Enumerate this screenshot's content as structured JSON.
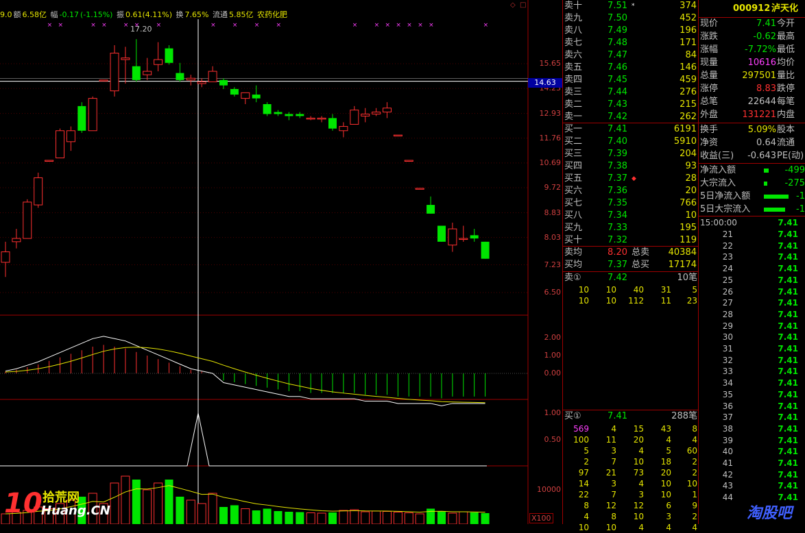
{
  "info_bar": {
    "prefix": "9.0",
    "amount_label": "额",
    "amount_value": "6.58亿",
    "change_label": "幅",
    "change_value": "-0.17",
    "change_pct": "(-1.15%)",
    "amp_label": "振",
    "amp_value": "0.61(4.11%)",
    "turnover_label": "换",
    "turnover_value": "7.65%",
    "float_label": "流通",
    "float_value": "5.85亿",
    "sector": "农药化肥"
  },
  "price_axis": [
    "15.65",
    "14.23",
    "12.93",
    "11.76",
    "10.69",
    "9.72",
    "8.83",
    "8.03",
    "7.23",
    "6.50"
  ],
  "price_axis_highlight": "14.63",
  "high_label": "17.20",
  "macd_axis": [
    "2.00",
    "1.00",
    "0.00"
  ],
  "kdj_axis": [
    "1.00",
    "0.50"
  ],
  "vol_axis": [
    "10000"
  ],
  "vol_unit": "X100",
  "colors": {
    "up": "#ff3030",
    "down": "#00e600",
    "axis": "#d04040",
    "grid": "#a00000",
    "yellow": "#e6e600",
    "magenta": "#ff40ff",
    "cyan": "#00e0e0"
  },
  "chart_data": {
    "type": "candlestick",
    "note_axis": "price",
    "candles": [
      {
        "o": 7.3,
        "h": 7.9,
        "l": 6.9,
        "c": 7.6
      },
      {
        "o": 7.9,
        "h": 8.3,
        "l": 7.7,
        "c": 8.0
      },
      {
        "o": 8.0,
        "h": 9.3,
        "l": 8.0,
        "c": 9.2
      },
      {
        "o": 9.1,
        "h": 10.3,
        "l": 9.0,
        "c": 10.1
      },
      {
        "o": 10.8,
        "h": 10.8,
        "l": 10.8,
        "c": 10.8
      },
      {
        "o": 10.9,
        "h": 12.2,
        "l": 10.9,
        "c": 12.1
      },
      {
        "o": 11.6,
        "h": 12.3,
        "l": 11.2,
        "c": 12.1
      },
      {
        "o": 13.3,
        "h": 13.5,
        "l": 12.0,
        "c": 12.1
      },
      {
        "o": 12.1,
        "h": 13.8,
        "l": 12.1,
        "c": 13.7
      },
      {
        "o": 14.7,
        "h": 14.7,
        "l": 14.7,
        "c": 14.7
      },
      {
        "o": 14.1,
        "h": 16.8,
        "l": 13.8,
        "c": 16.3
      },
      {
        "o": 15.9,
        "h": 16.7,
        "l": 14.5,
        "c": 16.0
      },
      {
        "o": 15.5,
        "h": 17.2,
        "l": 14.6,
        "c": 14.7
      },
      {
        "o": 15.0,
        "h": 16.0,
        "l": 14.7,
        "c": 15.2
      },
      {
        "o": 15.6,
        "h": 17.0,
        "l": 15.2,
        "c": 15.9
      },
      {
        "o": 16.6,
        "h": 16.8,
        "l": 15.6,
        "c": 15.7
      },
      {
        "o": 15.1,
        "h": 15.7,
        "l": 14.6,
        "c": 14.7
      },
      {
        "o": 14.7,
        "h": 15.0,
        "l": 14.4,
        "c": 14.8
      },
      {
        "o": 14.5,
        "h": 14.8,
        "l": 14.3,
        "c": 14.6
      },
      {
        "o": 14.6,
        "h": 15.5,
        "l": 14.6,
        "c": 15.2
      },
      {
        "o": 14.7,
        "h": 14.8,
        "l": 14.2,
        "c": 14.4
      },
      {
        "o": 14.2,
        "h": 14.3,
        "l": 13.8,
        "c": 13.9
      },
      {
        "o": 13.7,
        "h": 14.0,
        "l": 13.4,
        "c": 14.0
      },
      {
        "o": 13.9,
        "h": 14.4,
        "l": 13.5,
        "c": 13.7
      },
      {
        "o": 13.4,
        "h": 13.5,
        "l": 12.8,
        "c": 12.9
      },
      {
        "o": 13.0,
        "h": 13.1,
        "l": 12.8,
        "c": 12.9
      },
      {
        "o": 12.9,
        "h": 13.0,
        "l": 12.6,
        "c": 12.8
      },
      {
        "o": 12.9,
        "h": 13.0,
        "l": 12.7,
        "c": 12.8
      },
      {
        "o": 12.7,
        "h": 12.8,
        "l": 12.6,
        "c": 12.7
      },
      {
        "o": 12.7,
        "h": 12.8,
        "l": 12.5,
        "c": 12.7
      },
      {
        "o": 12.7,
        "h": 12.9,
        "l": 12.1,
        "c": 12.2
      },
      {
        "o": 12.1,
        "h": 12.5,
        "l": 11.8,
        "c": 12.3
      },
      {
        "o": 12.4,
        "h": 13.3,
        "l": 12.4,
        "c": 13.1
      },
      {
        "o": 12.8,
        "h": 13.2,
        "l": 12.5,
        "c": 12.9
      },
      {
        "o": 12.9,
        "h": 13.2,
        "l": 12.8,
        "c": 13.0
      },
      {
        "o": 13.0,
        "h": 13.5,
        "l": 12.7,
        "c": 13.2
      },
      {
        "o": 11.9,
        "h": 11.9,
        "l": 11.9,
        "c": 11.9
      },
      {
        "o": 10.8,
        "h": 10.8,
        "l": 10.8,
        "c": 10.8
      },
      {
        "o": 9.7,
        "h": 9.7,
        "l": 9.7,
        "c": 9.7
      },
      {
        "o": 9.1,
        "h": 9.4,
        "l": 8.8,
        "c": 8.8
      },
      {
        "o": 8.4,
        "h": 8.4,
        "l": 7.9,
        "c": 7.9
      },
      {
        "o": 7.8,
        "h": 8.5,
        "l": 7.6,
        "c": 8.3
      },
      {
        "o": 8.0,
        "h": 8.4,
        "l": 7.9,
        "c": 8.0
      },
      {
        "o": 8.1,
        "h": 8.3,
        "l": 7.9,
        "c": 8.0
      },
      {
        "o": 7.9,
        "h": 7.9,
        "l": 7.4,
        "c": 7.4
      }
    ],
    "macd_diff": [
      0.1,
      0.2,
      0.35,
      0.5,
      0.7,
      0.9,
      1.1,
      1.3,
      1.5,
      1.6,
      1.5,
      1.4,
      1.2,
      1.0,
      0.8,
      0.6,
      0.4,
      0.2,
      0.1,
      0.0,
      -0.4,
      -0.5,
      -0.6,
      -0.7,
      -0.8,
      -0.9,
      -1.0,
      -1.0,
      -1.1,
      -1.1,
      -1.1,
      -1.1,
      -1.1,
      -1.2,
      -1.2,
      -1.2,
      -1.3,
      -1.3,
      -1.3,
      -1.3,
      -1.4,
      -1.3,
      -1.3,
      -1.3,
      -1.3
    ],
    "vol": [
      3000,
      3500,
      4000,
      5000,
      4500,
      6000,
      7000,
      8000,
      9000,
      6000,
      12000,
      14000,
      13000,
      10000,
      12000,
      13000,
      8000,
      7000,
      6000,
      9000,
      5000,
      5500,
      4500,
      4000,
      4500,
      3800,
      3600,
      3500,
      3300,
      3200,
      3400,
      4000,
      4200,
      3600,
      3800,
      3700,
      3500,
      3300,
      3000,
      4500,
      3800,
      3200,
      3600,
      3400,
      3200
    ],
    "kdj_peak": {
      "value": 1.0
    }
  },
  "order_book": {
    "asks": [
      {
        "label": "卖十",
        "price": "7.51",
        "vol": "374",
        "mark": "*"
      },
      {
        "label": "卖九",
        "price": "7.50",
        "vol": "452",
        "mark": ""
      },
      {
        "label": "卖八",
        "price": "7.49",
        "vol": "196",
        "mark": ""
      },
      {
        "label": "卖七",
        "price": "7.48",
        "vol": "171",
        "mark": ""
      },
      {
        "label": "卖六",
        "price": "7.47",
        "vol": "84",
        "mark": ""
      },
      {
        "label": "卖五",
        "price": "7.46",
        "vol": "146",
        "mark": ""
      },
      {
        "label": "卖四",
        "price": "7.45",
        "vol": "459",
        "mark": ""
      },
      {
        "label": "卖三",
        "price": "7.44",
        "vol": "276",
        "mark": ""
      },
      {
        "label": "卖二",
        "price": "7.43",
        "vol": "215",
        "mark": ""
      },
      {
        "label": "卖一",
        "price": "7.42",
        "vol": "262",
        "mark": ""
      }
    ],
    "bids": [
      {
        "label": "买一",
        "price": "7.41",
        "vol": "6191",
        "mark": ""
      },
      {
        "label": "买二",
        "price": "7.40",
        "vol": "5910",
        "mark": ""
      },
      {
        "label": "买三",
        "price": "7.39",
        "vol": "204",
        "mark": ""
      },
      {
        "label": "买四",
        "price": "7.38",
        "vol": "93",
        "mark": ""
      },
      {
        "label": "买五",
        "price": "7.37",
        "vol": "28",
        "mark": "◆"
      },
      {
        "label": "买六",
        "price": "7.36",
        "vol": "20",
        "mark": ""
      },
      {
        "label": "买七",
        "price": "7.35",
        "vol": "766",
        "mark": ""
      },
      {
        "label": "买八",
        "price": "7.34",
        "vol": "10",
        "mark": ""
      },
      {
        "label": "买九",
        "price": "7.33",
        "vol": "195",
        "mark": ""
      },
      {
        "label": "买十",
        "price": "7.32",
        "vol": "119",
        "mark": ""
      }
    ],
    "avg": {
      "ask_avg_label": "卖均",
      "ask_avg": "8.20",
      "ask_total_label": "总卖",
      "ask_total": "40384",
      "bid_avg_label": "买均",
      "bid_avg": "7.37",
      "bid_total_label": "总买",
      "bid_total": "17174"
    },
    "ask1_queue": {
      "label": "卖①",
      "price": "7.42",
      "count": "10笔",
      "rows": [
        [
          "10",
          "10",
          "40",
          "31",
          "5"
        ],
        [
          "10",
          "10",
          "112",
          "11",
          "23"
        ]
      ]
    },
    "bid1_queue": {
      "label": "买①",
      "price": "7.41",
      "count": "288笔",
      "rows": [
        [
          "569",
          "4",
          "15",
          "43",
          "8"
        ],
        [
          "100",
          "11",
          "20",
          "4",
          "4"
        ],
        [
          "5",
          "3",
          "4",
          "5",
          "60"
        ],
        [
          "2",
          "7",
          "10",
          "18",
          "2"
        ],
        [
          "97",
          "21",
          "73",
          "20",
          "2"
        ],
        [
          "14",
          "3",
          "4",
          "10",
          "10"
        ],
        [
          "22",
          "7",
          "3",
          "10",
          "1"
        ],
        [
          "8",
          "12",
          "12",
          "6",
          "9"
        ],
        [
          "4",
          "8",
          "10",
          "3",
          "2"
        ],
        [
          "10",
          "10",
          "4",
          "4",
          "4"
        ]
      ]
    }
  },
  "quote": {
    "code": "000912",
    "name": "泸天化",
    "rows": [
      {
        "l": "现价",
        "v": "7.41",
        "c": "#00e600",
        "l2": "今开"
      },
      {
        "l": "涨跌",
        "v": "-0.62",
        "c": "#00e600",
        "l2": "最高"
      },
      {
        "l": "涨幅",
        "v": "-7.72%",
        "c": "#00e600",
        "l2": "最低"
      },
      {
        "l": "现量",
        "v": "10616",
        "c": "#ff40ff",
        "l2": "均价"
      },
      {
        "l": "总量",
        "v": "297501",
        "c": "#e6e600",
        "l2": "量比"
      },
      {
        "l": "涨停",
        "v": "8.83",
        "c": "#ff3030",
        "l2": "跌停"
      },
      {
        "l": "总笔",
        "v": "22644",
        "c": "#c0c0c0",
        "l2": "每笔"
      },
      {
        "l": "外盘",
        "v": "131221",
        "c": "#ff3030",
        "l2": "内盘"
      }
    ],
    "rows2": [
      {
        "l": "换手",
        "v": "5.09%",
        "c": "#e6e600",
        "l2": "股本"
      },
      {
        "l": "净资",
        "v": "0.64",
        "c": "#c0c0c0",
        "l2": "流通"
      },
      {
        "l": "收益(三)",
        "v": "-0.643",
        "c": "#c0c0c0",
        "l2": "PE(动)"
      }
    ],
    "flows": [
      {
        "l": "净流入额",
        "v": "-499",
        "bar": 6
      },
      {
        "l": "大宗流入",
        "v": "-275",
        "bar": 4
      },
      {
        "l": "5日净流入额",
        "v": "-1",
        "bar": 30
      },
      {
        "l": "5日大宗流入",
        "v": "-1",
        "bar": 26
      }
    ],
    "time_header": "15:00:00",
    "time_header_value": "7.41",
    "ticks": [
      {
        "t": "21",
        "v": "7.41"
      },
      {
        "t": "22",
        "v": "7.41"
      },
      {
        "t": "23",
        "v": "7.41"
      },
      {
        "t": "24",
        "v": "7.41"
      },
      {
        "t": "25",
        "v": "7.41"
      },
      {
        "t": "26",
        "v": "7.41"
      },
      {
        "t": "27",
        "v": "7.41"
      },
      {
        "t": "28",
        "v": "7.41"
      },
      {
        "t": "29",
        "v": "7.41"
      },
      {
        "t": "30",
        "v": "7.41"
      },
      {
        "t": "31",
        "v": "7.41"
      },
      {
        "t": "32",
        "v": "7.41"
      },
      {
        "t": "33",
        "v": "7.41"
      },
      {
        "t": "34",
        "v": "7.41"
      },
      {
        "t": "35",
        "v": "7.41"
      },
      {
        "t": "36",
        "v": "7.41"
      },
      {
        "t": "37",
        "v": "7.41"
      },
      {
        "t": "38",
        "v": "7.41"
      },
      {
        "t": "39",
        "v": "7.41"
      },
      {
        "t": "40",
        "v": "7.41"
      },
      {
        "t": "41",
        "v": "7.41"
      },
      {
        "t": "42",
        "v": "7.41"
      },
      {
        "t": "43",
        "v": "7.41"
      },
      {
        "t": "44",
        "v": "7.41"
      }
    ]
  },
  "watermarks": {
    "left_num": "10",
    "left_cn": "拾荒网",
    "left_site": "Huang.CN",
    "right": "淘股吧"
  }
}
